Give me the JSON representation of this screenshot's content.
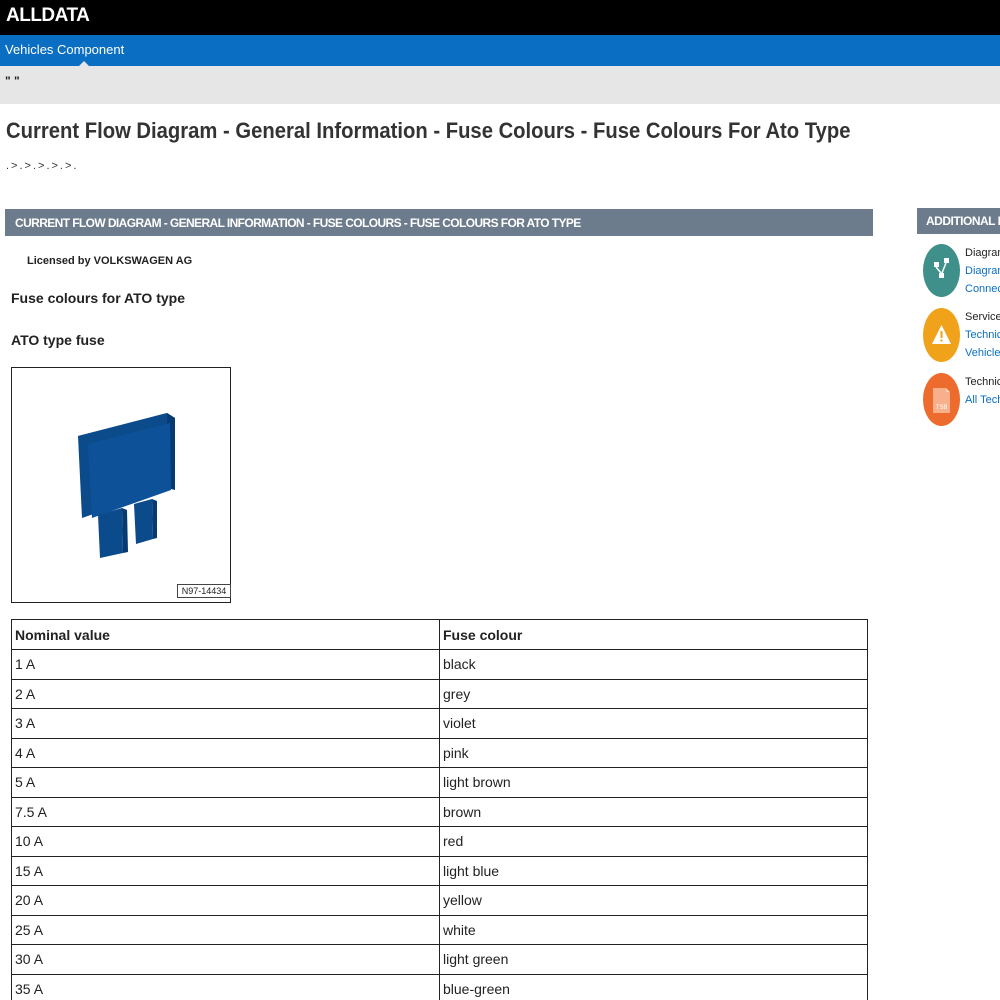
{
  "header": {
    "logo": "ALLDATA"
  },
  "nav": {
    "vehicles": "Vehicles",
    "component": "Component"
  },
  "subbar": {
    "text": "\" \""
  },
  "page": {
    "title": "Current Flow Diagram - General Information - Fuse Colours - Fuse Colours For Ato Type",
    "breadcrumb": ".>.>.>.>.>."
  },
  "section": {
    "header": "CURRENT FLOW DIAGRAM - GENERAL INFORMATION - FUSE COLOURS - FUSE COLOURS FOR ATO TYPE",
    "licensed": "Licensed by VOLKSWAGEN AG",
    "heading1": "Fuse colours for ATO type",
    "heading2": "ATO type fuse",
    "figure_label": "N97-14434"
  },
  "table": {
    "headers": [
      "Nominal value",
      "Fuse colour"
    ],
    "rows": [
      [
        "1 A",
        "black"
      ],
      [
        "2 A",
        "grey"
      ],
      [
        "3 A",
        "violet"
      ],
      [
        "4 A",
        "pink"
      ],
      [
        "5 A",
        "light brown"
      ],
      [
        "7.5 A",
        "brown"
      ],
      [
        "10 A",
        "red"
      ],
      [
        "15 A",
        "light blue"
      ],
      [
        "20 A",
        "yellow"
      ],
      [
        "25 A",
        "white"
      ],
      [
        "30 A",
        "light green"
      ],
      [
        "35 A",
        "blue-green"
      ]
    ]
  },
  "sidebar": {
    "header": "ADDITIONAL INFO",
    "items": [
      {
        "icon": "diagram-icon",
        "color": "#3f8f8a",
        "title": "Diagram",
        "links": [
          "Diagram",
          "Connecto"
        ]
      },
      {
        "icon": "warning-icon",
        "color": "#f0a21a",
        "title": "Service P",
        "links": [
          "Technicia",
          "Vehicle D"
        ]
      },
      {
        "icon": "tsb-icon",
        "color": "#ec6b2d",
        "title": "Technica",
        "links": [
          "All Techn"
        ]
      }
    ]
  },
  "colors": {
    "nav_blue": "#0a6fc2",
    "section_gray": "#6d7c8c",
    "fuse_blue": "#0b4a8b"
  }
}
